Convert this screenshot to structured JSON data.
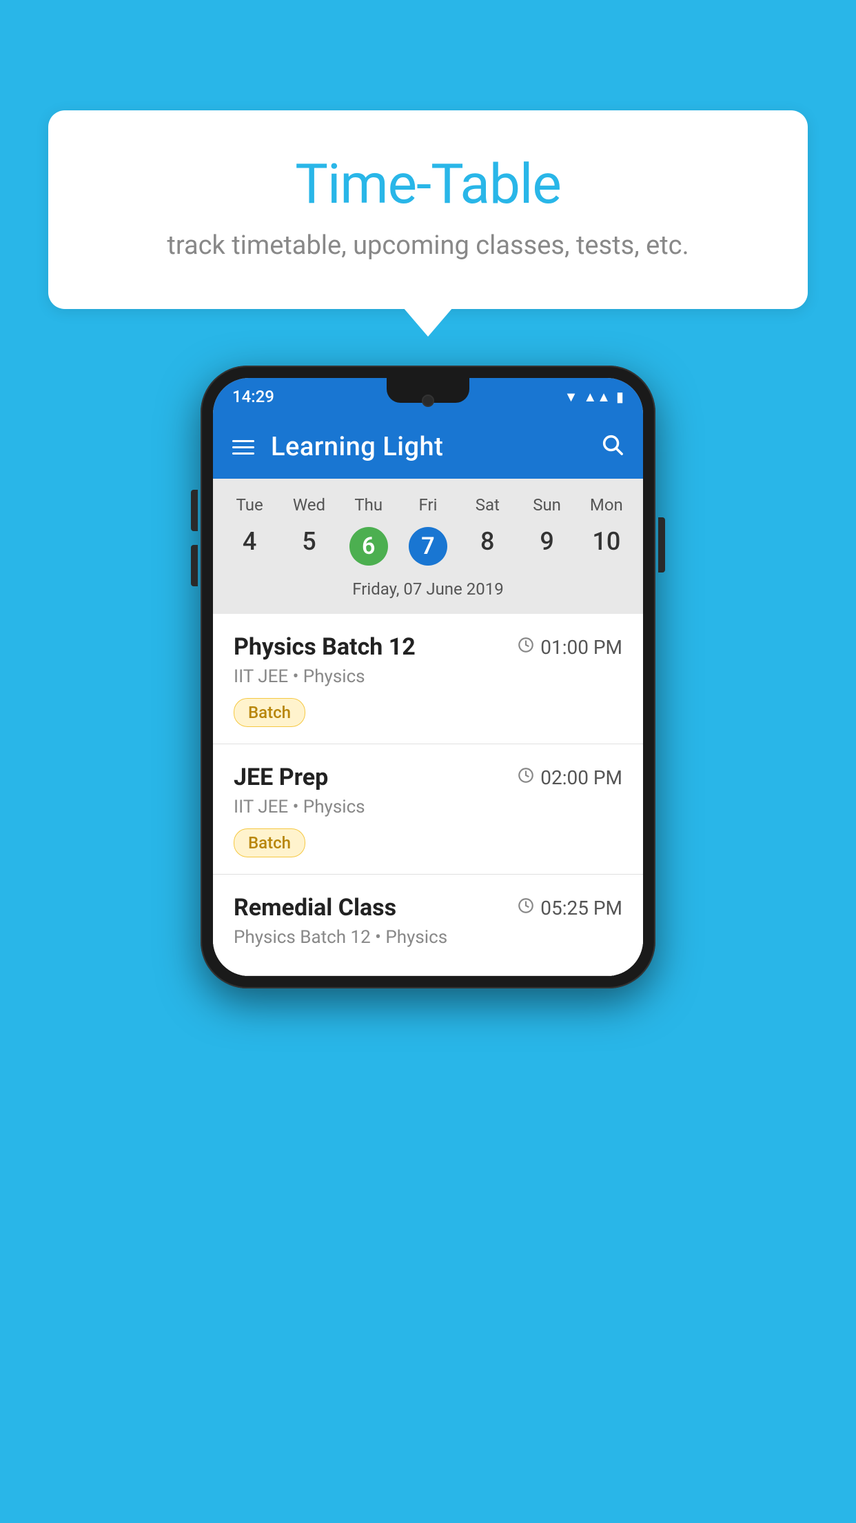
{
  "background_color": "#29b6e8",
  "bubble": {
    "title": "Time-Table",
    "subtitle": "track timetable, upcoming classes, tests, etc."
  },
  "phone": {
    "status_bar": {
      "time": "14:29"
    },
    "app_bar": {
      "title": "Learning Light"
    },
    "calendar": {
      "day_names": [
        "Tue",
        "Wed",
        "Thu",
        "Fri",
        "Sat",
        "Sun",
        "Mon"
      ],
      "day_numbers": [
        "4",
        "5",
        "6",
        "7",
        "8",
        "9",
        "10"
      ],
      "today_index": 2,
      "selected_index": 3,
      "selected_date_label": "Friday, 07 June 2019"
    },
    "schedule": [
      {
        "title": "Physics Batch 12",
        "time": "01:00 PM",
        "meta": "IIT JEE • Physics",
        "badge": "Batch"
      },
      {
        "title": "JEE Prep",
        "time": "02:00 PM",
        "meta": "IIT JEE • Physics",
        "badge": "Batch"
      },
      {
        "title": "Remedial Class",
        "time": "05:25 PM",
        "meta": "Physics Batch 12 • Physics",
        "badge": ""
      }
    ]
  }
}
